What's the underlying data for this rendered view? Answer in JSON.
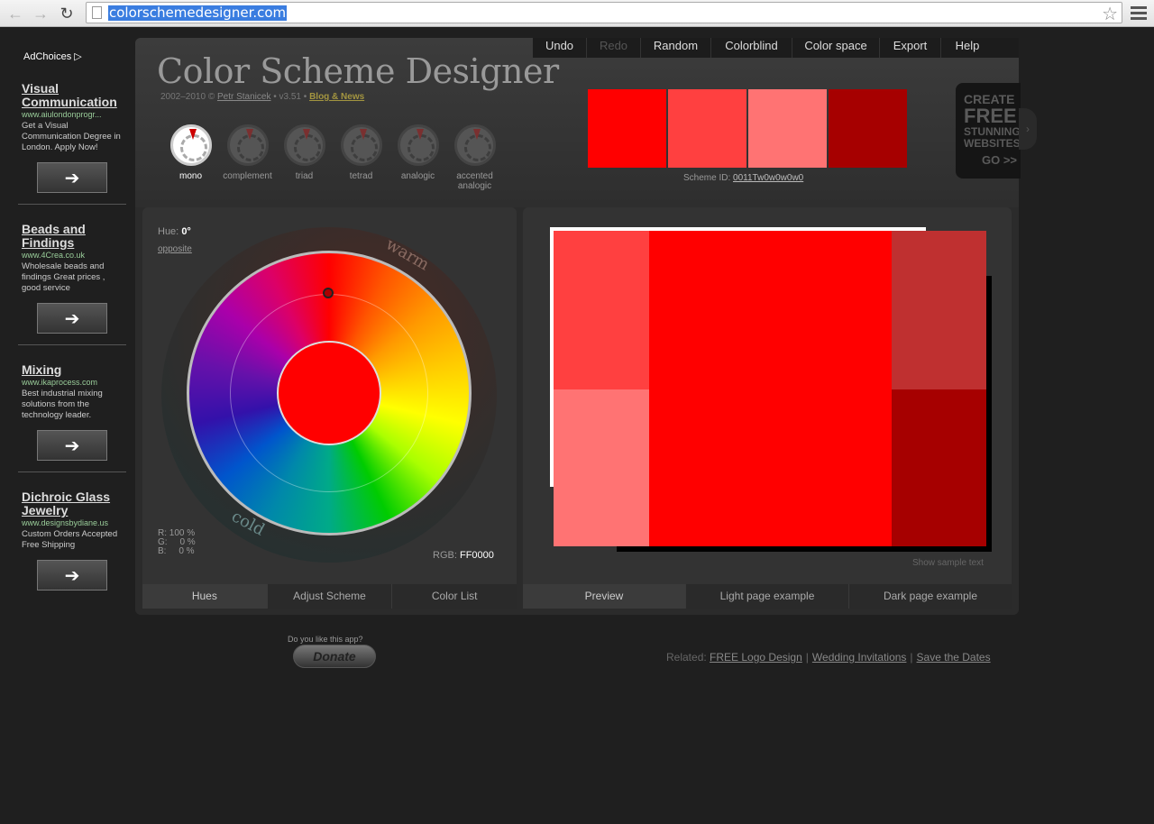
{
  "browser": {
    "url": "colorschemedesigner.com"
  },
  "ads": {
    "adchoices": "AdChoices",
    "items": [
      {
        "title": "Visual Communication",
        "url": "www.aiulondonprogr...",
        "desc": "Get a Visual Communication Degree in London. Apply Now!"
      },
      {
        "title": "Beads and Findings",
        "url": "www.4Crea.co.uk",
        "desc": "Wholesale beads and findings Great prices , good service"
      },
      {
        "title": "Mixing",
        "url": "www.ikaprocess.com",
        "desc": "Best industrial mixing solutions from the technology leader."
      },
      {
        "title": "Dichroic Glass Jewelry",
        "url": "www.designsbydiane.us",
        "desc": "Custom Orders Accepted Free Shipping"
      }
    ]
  },
  "header": {
    "logo": "Color Scheme Designer",
    "years": "2002–2010 ©",
    "author": "Petr Stanicek",
    "version": "• v3.51 •",
    "blog": "Blog & News"
  },
  "menu": [
    "Undo",
    "Redo",
    "Random",
    "Colorblind",
    "Color space",
    "Export",
    "Help"
  ],
  "scheme_types": [
    {
      "label": "mono",
      "active": true
    },
    {
      "label": "complement",
      "active": false
    },
    {
      "label": "triad",
      "active": false
    },
    {
      "label": "tetrad",
      "active": false
    },
    {
      "label": "analogic",
      "active": false
    },
    {
      "label": "accented analogic",
      "active": false
    }
  ],
  "swatches": [
    "#ff0000",
    "#ff4040",
    "#ff7373",
    "#a60000"
  ],
  "scheme_id": {
    "label": "Scheme ID:",
    "value": "0011Tw0w0w0w0"
  },
  "promo": {
    "l1": "CREATE",
    "l2": "FREE",
    "l3a": "STUNNING",
    "l3b": "WEBSITES",
    "l4": "GO >>"
  },
  "wheel": {
    "hue_label": "Hue:",
    "hue_value": "0°",
    "opposite": "opposite",
    "warm": "warm",
    "cold": "cold",
    "r": "R: 100 %",
    "g": "G:     0 %",
    "b": "B:     0 %",
    "rgb_label": "RGB:",
    "rgb_value": "FF0000"
  },
  "left_tabs": [
    "Hues",
    "Adjust Scheme",
    "Color List"
  ],
  "preview": {
    "colors": {
      "main": "#ff0000",
      "light1": "#ff4040",
      "light2": "#ff7373",
      "dark1": "#bf3030",
      "dark2": "#a60000"
    },
    "sample_text": "Show sample text"
  },
  "right_tabs": [
    "Preview",
    "Light page example",
    "Dark page example"
  ],
  "footer": {
    "donate_question": "Do you like this app?",
    "donate": "Donate",
    "related_label": "Related:",
    "links": [
      "FREE Logo Design",
      "Wedding Invitations",
      "Save the Dates"
    ]
  }
}
